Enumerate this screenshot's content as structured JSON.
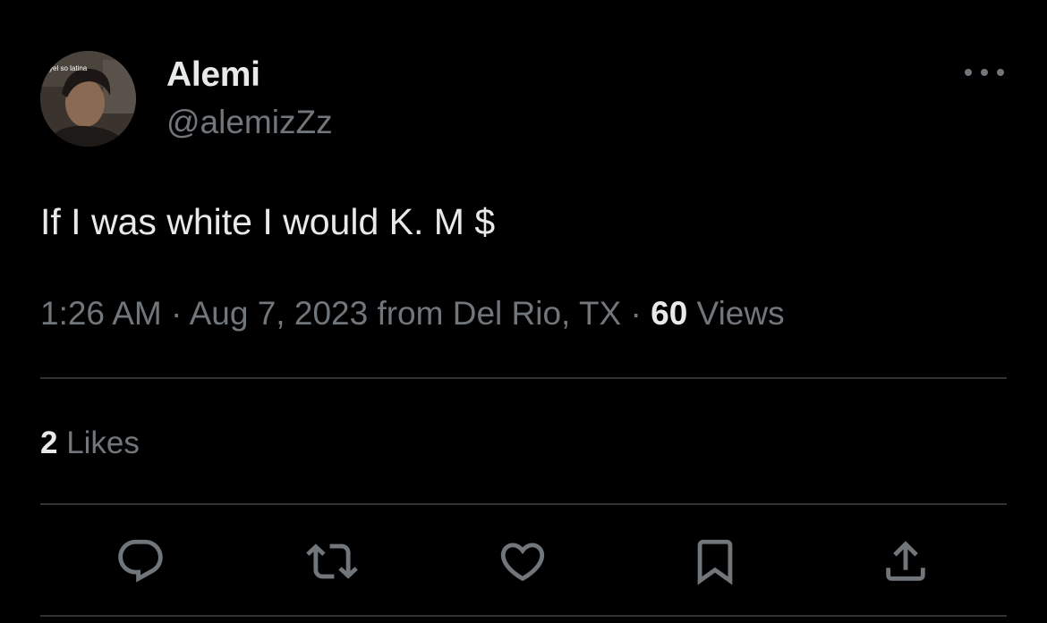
{
  "author": {
    "display_name": "Alemi",
    "handle": "@alemizZz",
    "avatar_caption": "yel so latina"
  },
  "tweet": {
    "text": "If I was white I would K. M $"
  },
  "meta": {
    "time": "1:26 AM",
    "separator": " · ",
    "date": "Aug 7, 2023",
    "location_prefix": " from ",
    "location": "Del Rio, TX",
    "views_count": "60",
    "views_label": " Views"
  },
  "stats": {
    "likes_count": "2",
    "likes_label": " Likes"
  },
  "actions": {
    "reply_icon": "reply-icon",
    "retweet_icon": "retweet-icon",
    "like_icon": "heart-icon",
    "bookmark_icon": "bookmark-icon",
    "share_icon": "share-icon",
    "more_icon": "more-icon"
  },
  "colors": {
    "background": "#000000",
    "primary_text": "#e7e9ea",
    "secondary_text": "#71767b",
    "divider": "#2f3336"
  }
}
